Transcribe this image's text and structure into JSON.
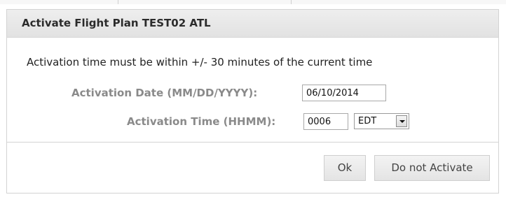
{
  "dialog": {
    "title": "Activate Flight Plan TEST02 ATL",
    "note": "Activation time must be within +/- 30 minutes of the current time",
    "date_label": "Activation Date (MM/DD/YYYY):",
    "date_value": "06/10/2014",
    "time_label": "Activation Time (HHMM):",
    "time_value": "0006",
    "timezone_value": "EDT",
    "ok_label": "Ok",
    "cancel_label": "Do not Activate"
  },
  "colors": {
    "titlebar_bg": "#e6e6e6",
    "label_text": "#8a8a8a",
    "border": "#d3d3d3"
  },
  "icons": {
    "select_arrow": "chevron-down-icon"
  }
}
